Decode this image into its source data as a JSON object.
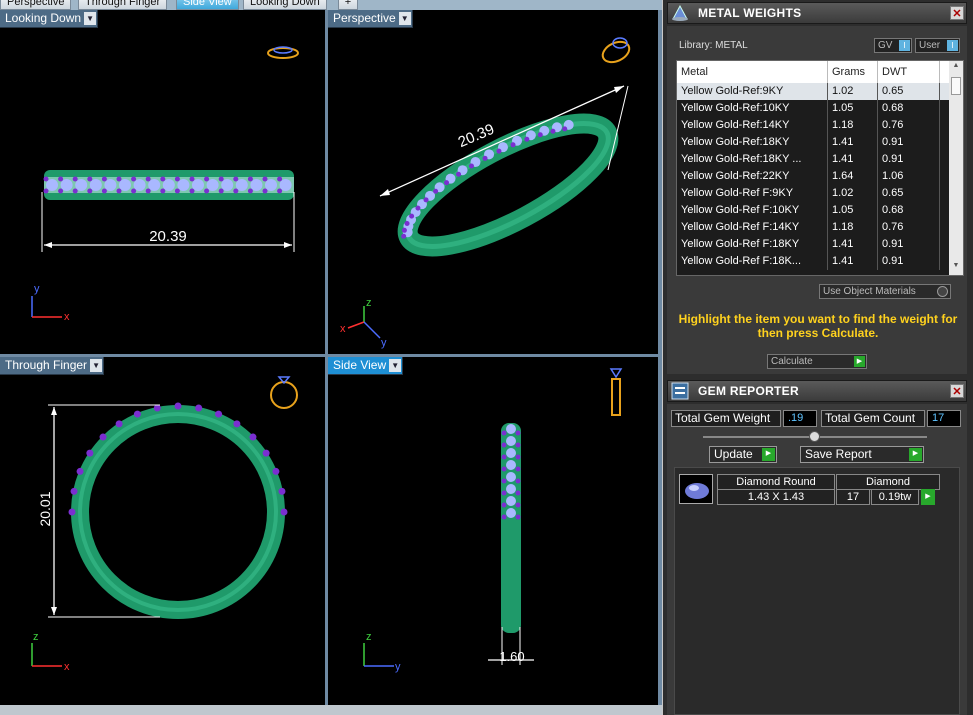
{
  "tabs": [
    "Perspective",
    "Through Finger",
    "Side View",
    "Looking Down"
  ],
  "active_tab": "Side View",
  "viewports": {
    "looking_down": {
      "label": "Looking Down",
      "dimension": "20.39",
      "axis_a": "y",
      "axis_b": "x"
    },
    "perspective": {
      "label": "Perspective",
      "dimension": "20.39",
      "axis_a": "z",
      "axis_b": "x",
      "axis_c": "y"
    },
    "through_finger": {
      "label": "Through Finger",
      "dimension": "20.01",
      "axis_a": "z",
      "axis_b": "x"
    },
    "side_view": {
      "label": "Side View",
      "dimension": "1.60",
      "axis_a": "z",
      "axis_b": "y"
    }
  },
  "metal_weights": {
    "title": "METAL WEIGHTS",
    "library": "Library: METAL",
    "toggle_gv": "GV",
    "toggle_user": "User",
    "columns": [
      "Metal",
      "Grams",
      "DWT"
    ],
    "rows": [
      [
        "Yellow Gold-Ref:9KY",
        "1.02",
        "0.65"
      ],
      [
        "Yellow Gold-Ref:10KY",
        "1.05",
        "0.68"
      ],
      [
        "Yellow Gold-Ref:14KY",
        "1.18",
        "0.76"
      ],
      [
        "Yellow Gold-Ref:18KY",
        "1.41",
        "0.91"
      ],
      [
        "Yellow Gold-Ref:18KY ...",
        "1.41",
        "0.91"
      ],
      [
        "Yellow Gold-Ref:22KY",
        "1.64",
        "1.06"
      ],
      [
        "Yellow Gold-Ref F:9KY",
        "1.02",
        "0.65"
      ],
      [
        "Yellow Gold-Ref F:10KY",
        "1.05",
        "0.68"
      ],
      [
        "Yellow Gold-Ref F:14KY",
        "1.18",
        "0.76"
      ],
      [
        "Yellow Gold-Ref F:18KY",
        "1.41",
        "0.91"
      ],
      [
        "Yellow Gold-Ref F:18K...",
        "1.41",
        "0.91"
      ]
    ],
    "use_object_materials": "Use Object Materials",
    "hint": "Highlight the item you want to find the weight for then press Calculate.",
    "calculate": "Calculate"
  },
  "gem_reporter": {
    "title": "GEM REPORTER",
    "total_weight_label": "Total Gem Weight",
    "total_weight": ".19",
    "total_count_label": "Total Gem Count",
    "total_count": "17",
    "update": "Update",
    "save_report": "Save Report",
    "gems": [
      {
        "shape": "Diamond Round",
        "size": "1.43 X 1.43",
        "material": "Diamond",
        "count": "17",
        "weight": "0.19tw"
      }
    ]
  },
  "colors": {
    "metal": "#1f9a6a",
    "gem": "#a9b8ff",
    "prong": "#7a2fd0",
    "dimension": "#ffffff",
    "hint": "#ffd21e"
  }
}
